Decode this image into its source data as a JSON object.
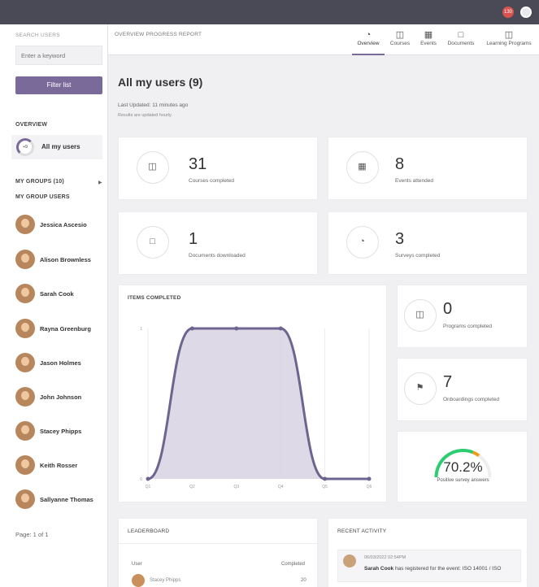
{
  "topbar": {
    "notification_count": "130"
  },
  "sidebar": {
    "search_label": "SEARCH USERS",
    "search_placeholder": "Enter a keyword",
    "filter_button": "Filter list",
    "overview_heading": "OVERVIEW",
    "all_users_count": "+9",
    "all_users_label": "All my users",
    "my_groups_label": "MY GROUPS (10)",
    "group_users_heading": "MY GROUP USERS",
    "members": [
      {
        "name": "Jessica Ascesio"
      },
      {
        "name": "Alison Brownless"
      },
      {
        "name": "Sarah Cook"
      },
      {
        "name": "Rayna Greenburg"
      },
      {
        "name": "Jason Holmes"
      },
      {
        "name": "John Johnson"
      },
      {
        "name": "Stacey Phipps"
      },
      {
        "name": "Keith Rosser"
      },
      {
        "name": "Sallyanne Thomas"
      }
    ],
    "pager": "Page: 1 of 1"
  },
  "header": {
    "report_title": "OVERVIEW PROGRESS REPORT",
    "tabs": [
      {
        "label": "Overview",
        "icon": "pie-icon"
      },
      {
        "label": "Courses",
        "icon": "book-icon"
      },
      {
        "label": "Events",
        "icon": "calendar-icon"
      },
      {
        "label": "Documents",
        "icon": "document-icon"
      },
      {
        "label": "Learning Programs",
        "icon": "programs-icon"
      }
    ]
  },
  "main": {
    "title": "All my users (9)",
    "last_updated": "Last Updated: 11 minutes ago",
    "results_note": "Results are updated hourly."
  },
  "stats": {
    "courses": {
      "value": "31",
      "caption": "Courses completed"
    },
    "events": {
      "value": "8",
      "caption": "Events attended"
    },
    "documents": {
      "value": "1",
      "caption": "Documents downloaded"
    },
    "surveys": {
      "value": "3",
      "caption": "Surveys completed"
    },
    "programs": {
      "value": "0",
      "caption": "Programs completed"
    },
    "onboardings": {
      "value": "7",
      "caption": "Onboardings completed"
    }
  },
  "gauge": {
    "value": "70.2%",
    "fraction": 0.702,
    "caption": "Positive survey answers"
  },
  "chart_data": {
    "type": "area",
    "title": "ITEMS COMPLETED",
    "categories": [
      "Q1",
      "Q2",
      "Q3",
      "Q4",
      "Q5",
      "Q6"
    ],
    "tick_labels": [
      "Q1",
      "Q2",
      "Q3",
      "Q4",
      "Q5",
      "Q6"
    ],
    "values": [
      0,
      1,
      1,
      1,
      0,
      0
    ],
    "ylim": [
      0,
      1
    ],
    "y_ticks": [
      "0",
      "1"
    ],
    "grid": true,
    "color": "#6e6490",
    "fill": "#d9d5e4"
  },
  "leaderboard": {
    "title": "LEADERBOARD",
    "col_user": "User",
    "col_completed": "Completed",
    "rows": [
      {
        "name": "Stacey Phipps",
        "value": "20"
      }
    ]
  },
  "activity": {
    "title": "RECENT ACTIVITY",
    "items": [
      {
        "time": "06/03/2022 02:54PM",
        "user": "Sarah Cook",
        "text": "has registered for the event: ISO 14001 / ISO"
      }
    ]
  },
  "colors": {
    "accent": "#7a6a9a",
    "gauge_green": "#2ecc71",
    "gauge_orange": "#f39c12"
  }
}
